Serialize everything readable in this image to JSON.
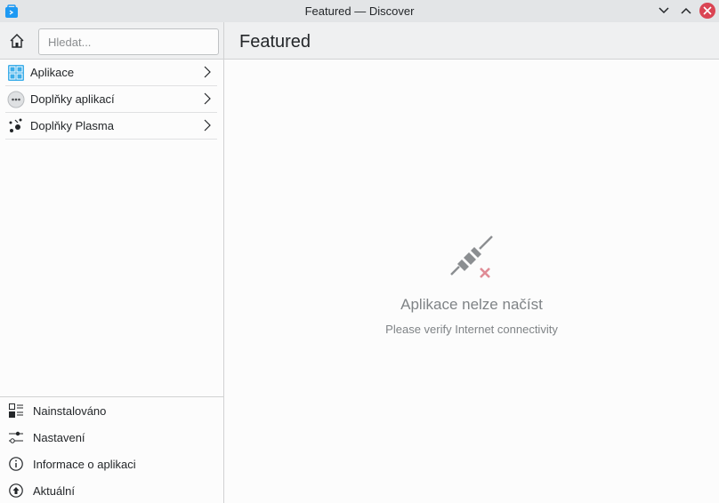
{
  "window": {
    "title": "Featured — Discover"
  },
  "search": {
    "placeholder": "Hledat..."
  },
  "categories": [
    {
      "label": "Aplikace",
      "icon": "applications-grid-icon"
    },
    {
      "label": "Doplňky aplikací",
      "icon": "addons-dots-icon"
    },
    {
      "label": "Doplňky Plasma",
      "icon": "plasma-icon"
    }
  ],
  "bottom_nav": [
    {
      "label": "Nainstalováno",
      "icon": "installed-icon"
    },
    {
      "label": "Nastavení",
      "icon": "settings-sliders-icon"
    },
    {
      "label": "Informace o aplikaci",
      "icon": "info-icon"
    },
    {
      "label": "Aktuální",
      "icon": "update-arrow-icon"
    }
  ],
  "main": {
    "page_title": "Featured",
    "empty_title": "Aplikace nelze načíst",
    "empty_subtitle": "Please verify Internet connectivity"
  },
  "colors": {
    "accent": "#3daee9",
    "close": "#da4453",
    "error_x": "#e08c96"
  }
}
